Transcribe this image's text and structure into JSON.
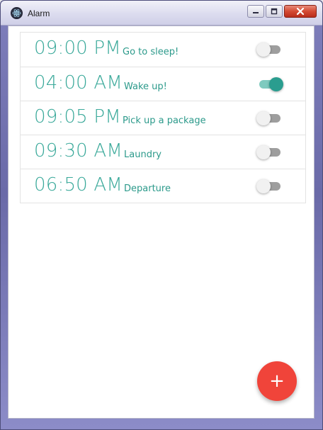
{
  "window": {
    "title": "Alarm",
    "app_icon": "electron-atom-icon",
    "controls": [
      "minimize-icon",
      "maximize-icon",
      "close-icon"
    ]
  },
  "alarms": [
    {
      "time": "09:00 PM",
      "label": "Go to sleep!",
      "enabled": false
    },
    {
      "time": "04:00 AM",
      "label": "Wake up!",
      "enabled": true
    },
    {
      "time": "09:05 PM",
      "label": "Pick up a package",
      "enabled": false
    },
    {
      "time": "09:30 AM",
      "label": "Laundry",
      "enabled": false
    },
    {
      "time": "06:50 AM",
      "label": "Departure",
      "enabled": false
    }
  ],
  "fab": {
    "icon": "plus-icon",
    "symbol": "+"
  },
  "colors": {
    "accent_teal": "#3aa99a",
    "toggle_on": "#2a9d8f",
    "toggle_off": "#9e9e9e",
    "fab_red": "#f0443a"
  }
}
